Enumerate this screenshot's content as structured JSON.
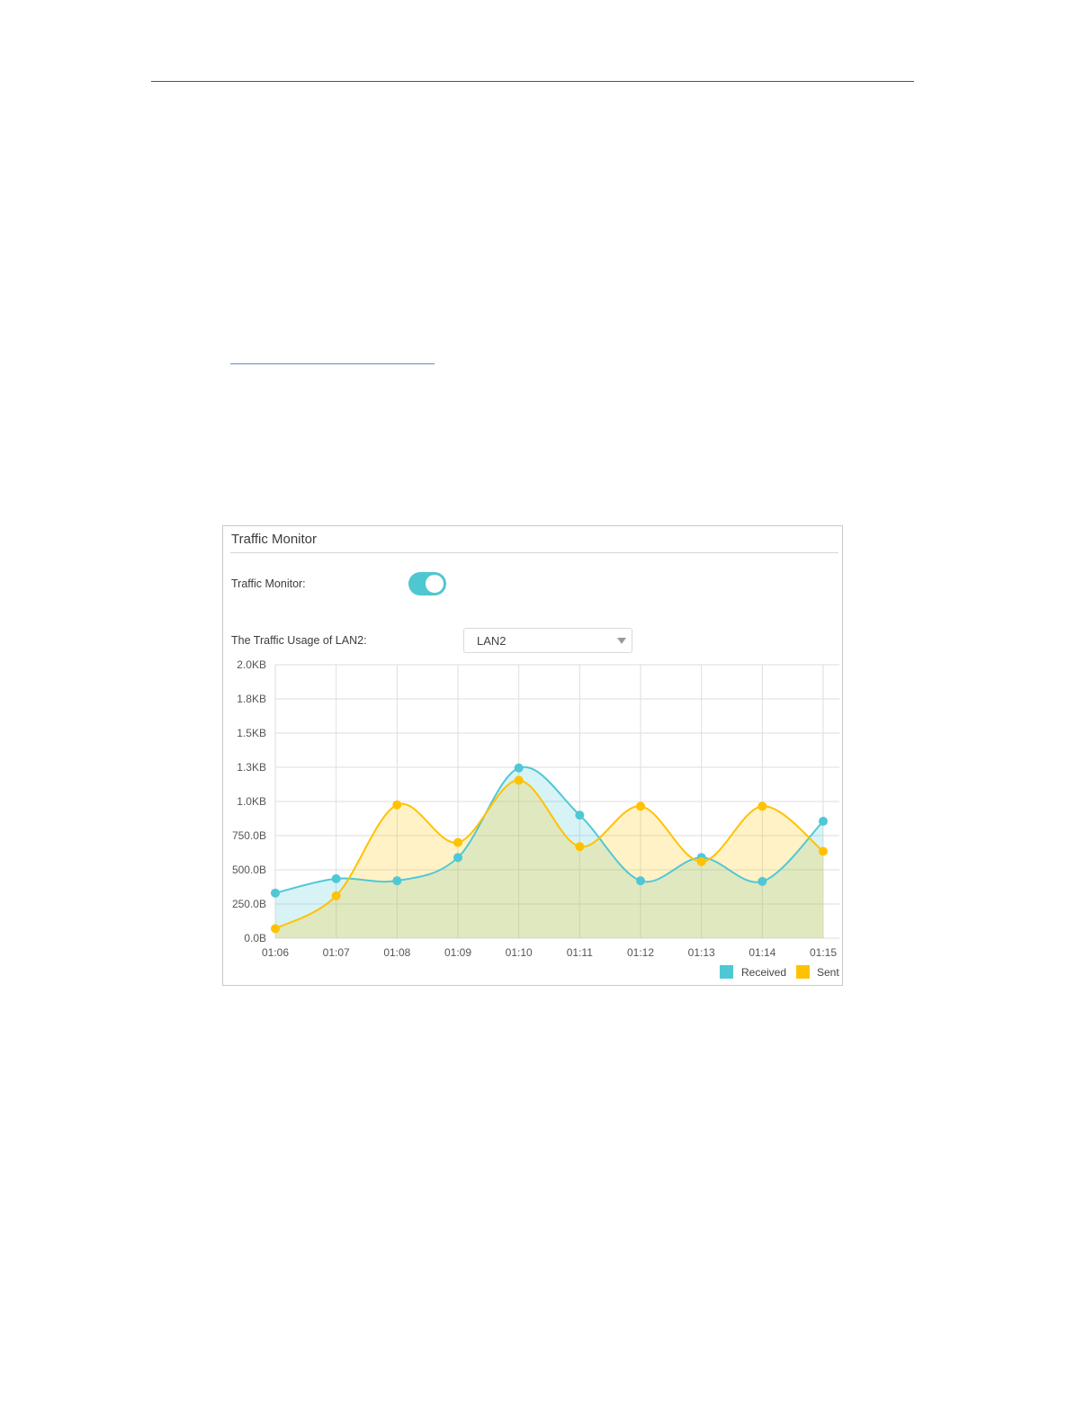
{
  "panel": {
    "title": "Traffic Monitor",
    "toggle_label": "Traffic Monitor:",
    "toggle_on": true,
    "usage_label": "The Traffic Usage of LAN2:",
    "lan_select_value": "LAN2"
  },
  "colors": {
    "received": "#4fc8d6",
    "sent": "#ffc200",
    "toggle": "#4fc7d0"
  },
  "icons": {
    "dropdown": "chevron-down-icon"
  },
  "chart_data": {
    "type": "area",
    "x": [
      "01:06",
      "01:07",
      "01:08",
      "01:09",
      "01:10",
      "01:11",
      "01:12",
      "01:13",
      "01:14",
      "01:15"
    ],
    "y_tick_labels": [
      "0.0B",
      "250.0B",
      "500.0B",
      "750.0B",
      "1.0KB",
      "1.3KB",
      "1.5KB",
      "1.8KB",
      "2.0KB"
    ],
    "ylim": [
      0,
      2000
    ],
    "grid": true,
    "legend_position": "bottom-right",
    "series": [
      {
        "name": "Received",
        "values": [
          330,
          435,
          420,
          590,
          1245,
          900,
          420,
          590,
          415,
          855
        ]
      },
      {
        "name": "Sent",
        "values": [
          70,
          310,
          975,
          700,
          1155,
          670,
          965,
          560,
          965,
          635
        ]
      }
    ]
  }
}
